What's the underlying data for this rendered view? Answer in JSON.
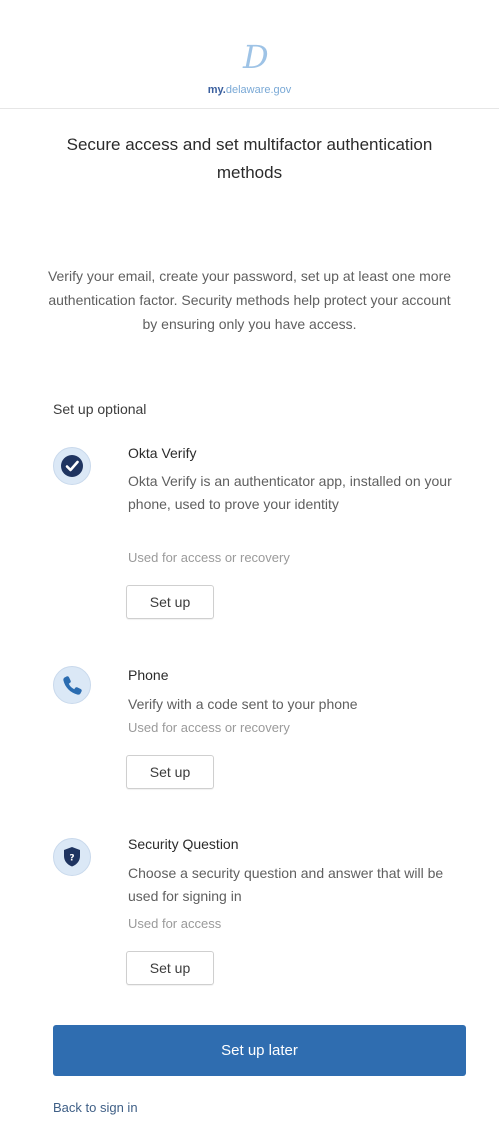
{
  "header": {
    "logo_mark": "D",
    "logo_prefix": "my.",
    "logo_domain": "delaware.gov"
  },
  "title": "Secure access and set multifactor authentication methods",
  "intro": "Verify your email, create your password, set up at least one more authentication factor. Security methods help protect your account by ensuring only you have access.",
  "section_label": "Set up optional",
  "methods": [
    {
      "icon": "okta-verify-icon",
      "title": "Okta Verify",
      "description": "Okta Verify is an authenticator app, installed on your phone, used to prove your identity",
      "usage": "Used for access or recovery",
      "button_label": "Set up"
    },
    {
      "icon": "phone-icon",
      "title": "Phone",
      "description": "Verify with a code sent to your phone",
      "usage": "Used for access or recovery",
      "button_label": "Set up"
    },
    {
      "icon": "security-question-icon",
      "title": "Security Question",
      "description": "Choose a security question and answer that will be used for signing in",
      "usage": "Used for access",
      "button_label": "Set up"
    }
  ],
  "later_button_label": "Set up later",
  "back_link_label": "Back to sign in",
  "colors": {
    "primary": "#2f6db0",
    "icon_bg": "#dbe8f6",
    "icon_dark": "#1f3460",
    "phone_blue": "#2b6cb0"
  }
}
